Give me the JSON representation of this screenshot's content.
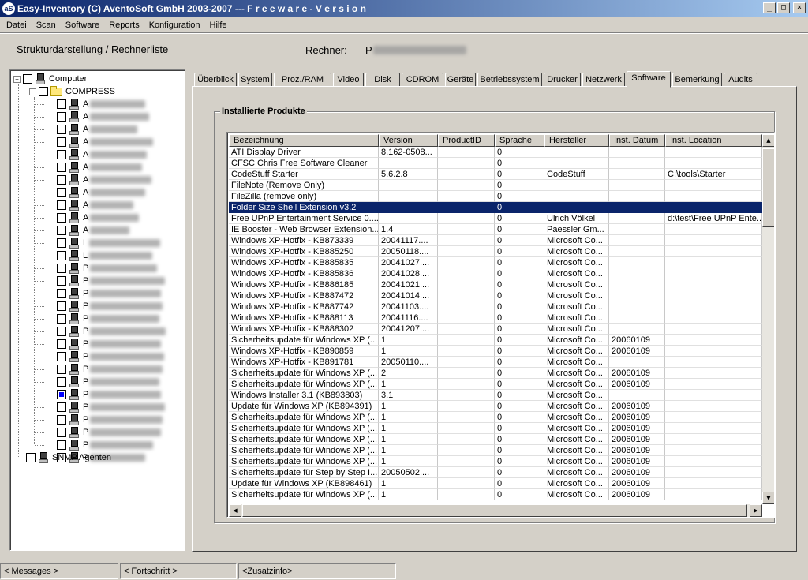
{
  "window": {
    "icon_text": "aS",
    "title": "Easy-Inventory (C) AventoSoft GmbH 2003-2007 --- F r e e w a r e - V e r s i o n",
    "min": "_",
    "max": "□",
    "close": "×"
  },
  "menu": [
    "Datei",
    "Scan",
    "Software",
    "Reports",
    "Konfiguration",
    "Hilfe"
  ],
  "header": {
    "left": "Strukturdarstellung / Rechnerliste",
    "rechner_label": "Rechner:",
    "rechner_value": "P"
  },
  "tree": {
    "root": "Computer",
    "group": "COMPRESS",
    "computers": [
      "A",
      "A",
      "A",
      "A",
      "A",
      "A",
      "A",
      "A",
      "A",
      "A",
      "A",
      "L",
      "L",
      "P",
      "P",
      "P",
      "P",
      "P",
      "P",
      "P",
      "P",
      "P",
      "P",
      "P",
      "P",
      "P",
      "P",
      "P",
      "P"
    ],
    "snmp": "SNMP Agenten"
  },
  "tabs": [
    "Überblick",
    "System",
    "Proz./RAM",
    "Video",
    "Disk",
    "CDROM",
    "Geräte",
    "Betriebssystem",
    "Drucker",
    "Netzwerk",
    "Software",
    "Bemerkung",
    "Audits"
  ],
  "active_tab": "Software",
  "group_title": "Installierte Produkte",
  "columns": [
    "Bezeichnung",
    "Version",
    "ProductID",
    "Sprache",
    "Hersteller",
    "Inst. Datum",
    "Inst. Location"
  ],
  "rows": [
    [
      "ATI Display Driver",
      "8.162-0508...",
      "",
      "0",
      "",
      "",
      ""
    ],
    [
      "CFSC Chris Free Software Cleaner",
      "",
      "",
      "0",
      "",
      "",
      ""
    ],
    [
      "CodeStuff Starter",
      "5.6.2.8",
      "",
      "0",
      "CodeStuff",
      "",
      "C:\\tools\\Starter"
    ],
    [
      "FileNote (Remove Only)",
      "",
      "",
      "0",
      "",
      "",
      ""
    ],
    [
      "FileZilla (remove only)",
      "",
      "",
      "0",
      "",
      "",
      ""
    ],
    [
      "Folder Size Shell Extension v3.2",
      "",
      "",
      "0",
      "",
      "",
      ""
    ],
    [
      "Free UPnP Entertainment Service 0....",
      "",
      "",
      "0",
      "Ulrich Völkel",
      "",
      "d:\\test\\Free UPnP Ente..."
    ],
    [
      "IE Booster - Web Browser Extension...",
      "1.4",
      "",
      "0",
      "Paessler Gm...",
      "",
      ""
    ],
    [
      "Windows XP-Hotfix - KB873339",
      "20041117....",
      "",
      "0",
      "Microsoft Co...",
      "",
      ""
    ],
    [
      "Windows XP-Hotfix - KB885250",
      "20050118....",
      "",
      "0",
      "Microsoft Co...",
      "",
      ""
    ],
    [
      "Windows XP-Hotfix - KB885835",
      "20041027....",
      "",
      "0",
      "Microsoft Co...",
      "",
      ""
    ],
    [
      "Windows XP-Hotfix - KB885836",
      "20041028....",
      "",
      "0",
      "Microsoft Co...",
      "",
      ""
    ],
    [
      "Windows XP-Hotfix - KB886185",
      "20041021....",
      "",
      "0",
      "Microsoft Co...",
      "",
      ""
    ],
    [
      "Windows XP-Hotfix - KB887472",
      "20041014....",
      "",
      "0",
      "Microsoft Co...",
      "",
      ""
    ],
    [
      "Windows XP-Hotfix - KB887742",
      "20041103....",
      "",
      "0",
      "Microsoft Co...",
      "",
      ""
    ],
    [
      "Windows XP-Hotfix - KB888113",
      "20041116....",
      "",
      "0",
      "Microsoft Co...",
      "",
      ""
    ],
    [
      "Windows XP-Hotfix - KB888302",
      "20041207....",
      "",
      "0",
      "Microsoft Co...",
      "",
      ""
    ],
    [
      "Sicherheitsupdate für Windows XP (...",
      "1",
      "",
      "0",
      "Microsoft Co...",
      "20060109",
      ""
    ],
    [
      "Windows XP-Hotfix - KB890859",
      "1",
      "",
      "0",
      "Microsoft Co...",
      "20060109",
      ""
    ],
    [
      "Windows XP-Hotfix - KB891781",
      "20050110....",
      "",
      "0",
      "Microsoft Co...",
      "",
      ""
    ],
    [
      "Sicherheitsupdate für Windows XP (...",
      "2",
      "",
      "0",
      "Microsoft Co...",
      "20060109",
      ""
    ],
    [
      "Sicherheitsupdate für Windows XP (...",
      "1",
      "",
      "0",
      "Microsoft Co...",
      "20060109",
      ""
    ],
    [
      "Windows Installer 3.1 (KB893803)",
      "3.1",
      "",
      "0",
      "Microsoft Co...",
      "",
      ""
    ],
    [
      "Update für Windows XP (KB894391)",
      "1",
      "",
      "0",
      "Microsoft Co...",
      "20060109",
      ""
    ],
    [
      "Sicherheitsupdate für Windows XP (...",
      "1",
      "",
      "0",
      "Microsoft Co...",
      "20060109",
      ""
    ],
    [
      "Sicherheitsupdate für Windows XP (...",
      "1",
      "",
      "0",
      "Microsoft Co...",
      "20060109",
      ""
    ],
    [
      "Sicherheitsupdate für Windows XP (...",
      "1",
      "",
      "0",
      "Microsoft Co...",
      "20060109",
      ""
    ],
    [
      "Sicherheitsupdate für Windows XP (...",
      "1",
      "",
      "0",
      "Microsoft Co...",
      "20060109",
      ""
    ],
    [
      "Sicherheitsupdate für Windows XP (...",
      "1",
      "",
      "0",
      "Microsoft Co...",
      "20060109",
      ""
    ],
    [
      "Sicherheitsupdate für Step by Step I...",
      "20050502....",
      "",
      "0",
      "Microsoft Co...",
      "20060109",
      ""
    ],
    [
      "Update für Windows XP (KB898461)",
      "1",
      "",
      "0",
      "Microsoft Co...",
      "20060109",
      ""
    ],
    [
      "Sicherheitsupdate für Windows XP (...",
      "1",
      "",
      "0",
      "Microsoft Co...",
      "20060109",
      ""
    ]
  ],
  "selected_row": 5,
  "status": [
    "< Messages >",
    "< Fortschritt >",
    "<Zusatzinfo>"
  ],
  "colors": {
    "selection": "#0a246a",
    "title_gradient_start": "#0a246a",
    "title_gradient_end": "#a6caf0"
  }
}
